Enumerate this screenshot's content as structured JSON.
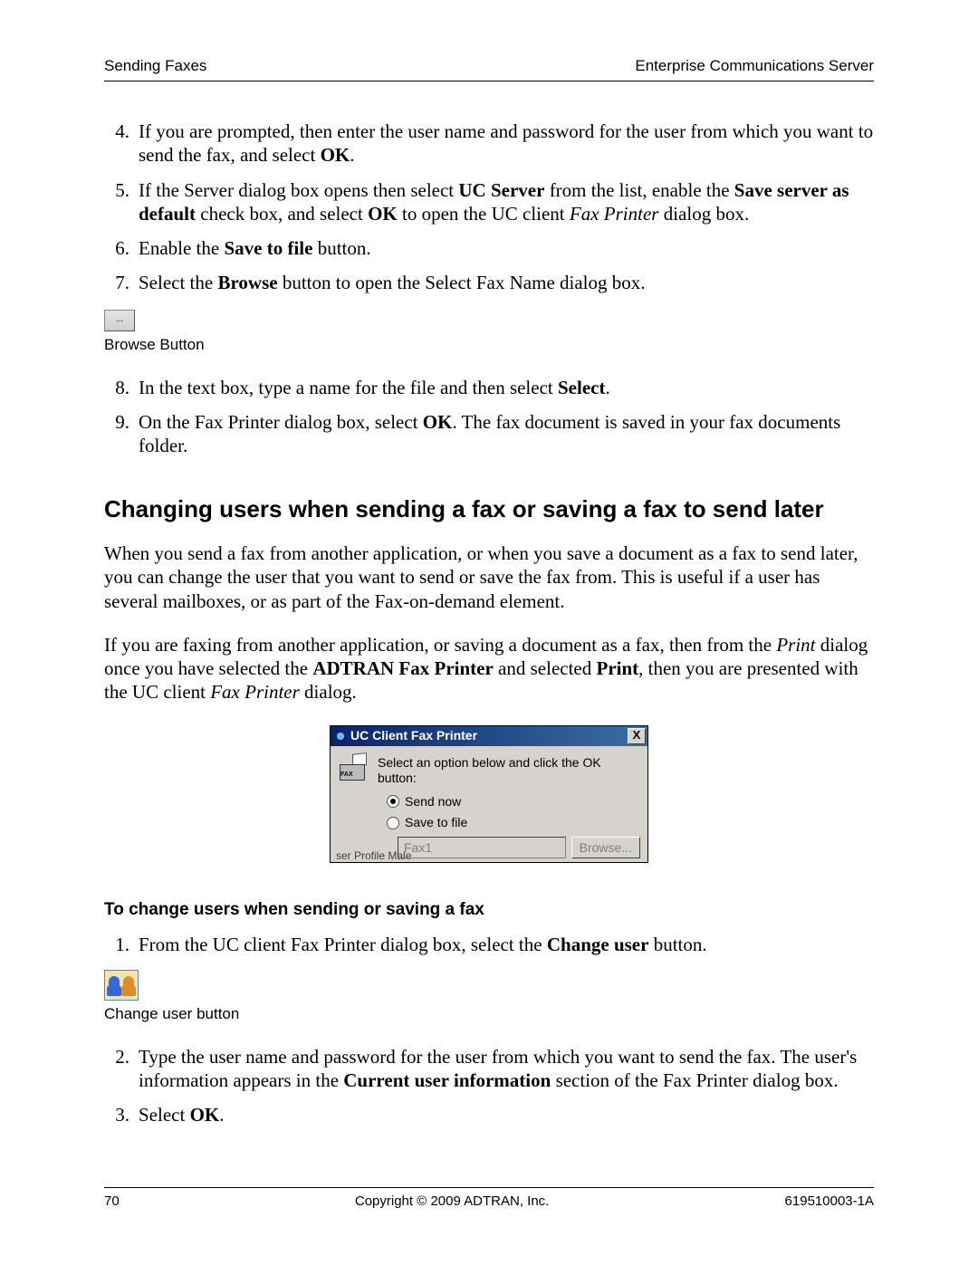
{
  "header": {
    "left": "Sending Faxes",
    "right": "Enterprise Communications Server"
  },
  "stepsA": [
    {
      "n": "4.",
      "plain1": "If you are prompted, then enter the user name and password for the user from which you want to send the fax, and select ",
      "b1": "OK",
      "plain2": "."
    },
    {
      "n": "5.",
      "parts": "complex5"
    },
    {
      "n": "6.",
      "plain1": "Enable the ",
      "b1": "Save to file",
      "plain2": " button."
    },
    {
      "n": "7.",
      "plain1": "Select the ",
      "b1": "Browse",
      "plain2": " button to open the Select Fax Name dialog box."
    }
  ],
  "step5": {
    "a": "If the Server dialog box opens then select ",
    "b1": "UC Server",
    "b": " from the list, enable the ",
    "b2": "Save server as default",
    "c": " check box, and select ",
    "b3": "OK",
    "d": " to open the UC client ",
    "i1": "Fax Printer",
    "e": " dialog box."
  },
  "browse_btn_ellipsis": "...",
  "browse_caption": "Browse Button",
  "stepsB": [
    {
      "n": "8.",
      "plain1": "In the text box, type a name for the file and then select ",
      "b1": "Select",
      "plain2": "."
    },
    {
      "n": "9.",
      "plain1": "On the Fax Printer dialog box, select ",
      "b1": "OK",
      "plain2": ". The fax document is saved in your fax documents folder."
    }
  ],
  "section_title": "Changing users when sending a fax or saving a fax to send later",
  "para1": "When you send a fax from another application, or when you save a document as a fax to send later, you can change the user that you want to send or save the fax from. This is useful if a user has several mailboxes, or as part of the Fax-on-demand element.",
  "para2": {
    "a": "If you are faxing from another application, or saving a document as a fax, then from the ",
    "i1": "Print",
    "b": " dialog once you have selected the ",
    "b1": "ADTRAN Fax Printer",
    "c": " and selected ",
    "b2": "Print",
    "d": ", then you are presented with the UC client ",
    "i2": "Fax Printer",
    "e": " dialog."
  },
  "dialog": {
    "title": "UC Client Fax Printer",
    "close": "X",
    "fax_label": "FAX",
    "prompt": "Select an option below and click the OK button:",
    "opt_send": "Send now",
    "opt_save": "Save to file",
    "textbox": "Fax1",
    "browse": "Browse...",
    "torn": "ser Profile   Male"
  },
  "sub_title": "To change users when sending or saving a fax",
  "stepsC1": {
    "n": "1.",
    "a": "From the UC client Fax Printer dialog box, select the ",
    "b1": "Change user",
    "b": " button."
  },
  "change_user_caption": "Change user button",
  "stepsC2": {
    "n": "2.",
    "a": "Type the user name and password for the user from which you want to send the fax. The user's information appears in the ",
    "b1": "Current user information",
    "b": " section of the Fax Printer dialog box."
  },
  "stepsC3": {
    "n": "3.",
    "a": "Select ",
    "b1": "OK",
    "b": "."
  },
  "footer": {
    "page": "70",
    "center": "Copyright © 2009 ADTRAN, Inc.",
    "right": "619510003-1A"
  }
}
